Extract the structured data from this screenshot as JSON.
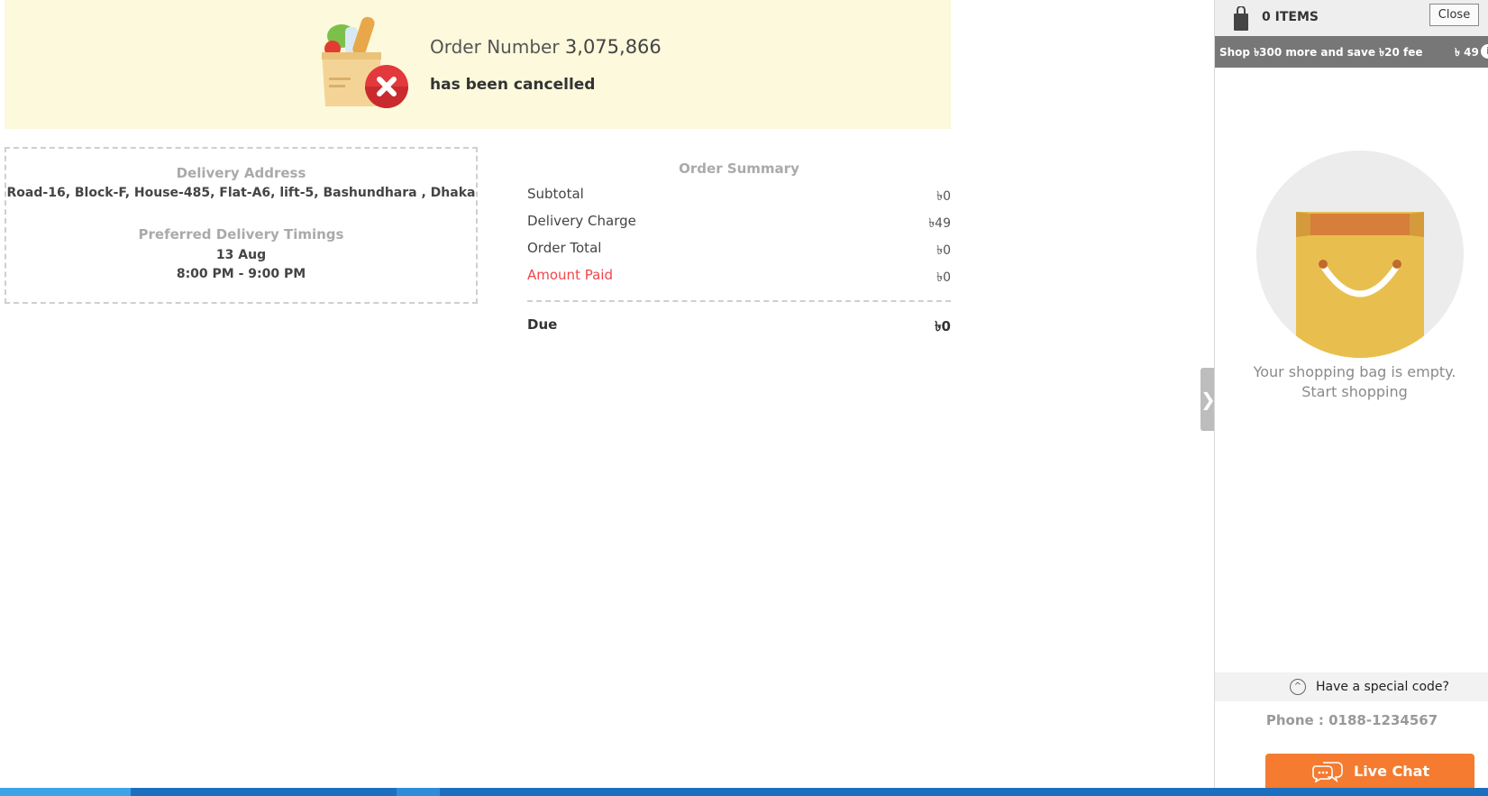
{
  "banner": {
    "order_label": "Order Number",
    "order_number": "3,075,866",
    "status_text": "has been cancelled"
  },
  "delivery": {
    "address_title": "Delivery Address",
    "address": "Road-16, Block-F, House-485, Flat-A6, lift-5, Bashundhara , Dhaka",
    "timing_title": "Preferred Delivery Timings",
    "date": "13 Aug",
    "time": "8:00 PM - 9:00 PM"
  },
  "summary": {
    "title": "Order Summary",
    "rows": [
      {
        "label": "Subtotal",
        "value": "৳0"
      },
      {
        "label": "Delivery Charge",
        "value": "৳49"
      },
      {
        "label": "Order Total",
        "value": "৳0"
      },
      {
        "label": "Amount Paid",
        "value": "৳0"
      }
    ],
    "due_label": "Due",
    "due_value": "৳0"
  },
  "cart": {
    "item_count": "0 ITEMS",
    "close_label": "Close",
    "promo_text": "Shop ৳300 more and save ৳20 fee",
    "promo_fee": "৳ 49",
    "info_glyph": "i",
    "collapse_glyph": "❯",
    "empty_message": "Your shopping bag is empty. Start shopping",
    "special_code_glyph": "^",
    "special_code_label": "Have a special code?",
    "phone": "Phone : 0188-1234567",
    "live_chat_label": "Live Chat"
  },
  "colors": {
    "banner_bg": "#fcf9dc",
    "accent_red": "#f0464b",
    "live_chat": "#f47b2f",
    "promo_bar": "#777777"
  },
  "icons": [
    "grocery-bag-icon",
    "cancel-x-icon",
    "shopping-bag-icon",
    "info-icon",
    "chevron-up-icon",
    "chat-bubble-icon",
    "chevron-right-icon"
  ]
}
